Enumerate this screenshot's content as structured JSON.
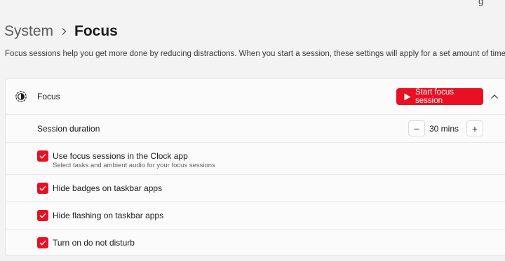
{
  "header": {
    "breadcrumb_parent": "System",
    "breadcrumb_current": "Focus",
    "partial_top_text": "g"
  },
  "description": "Focus sessions help you get more done by reducing distractions. When you start a session, these settings will apply for a set amount of time.",
  "focus_card": {
    "title": "Focus",
    "start_button_label": "Start focus session",
    "session_duration": {
      "label": "Session duration",
      "value": "30 mins",
      "decrement_label": "−",
      "increment_label": "+"
    },
    "options": [
      {
        "label": "Use focus sessions in the Clock app",
        "sublabel": "Select tasks and ambient audio for your focus sessions",
        "checked": true
      },
      {
        "label": "Hide badges on taskbar apps",
        "checked": true
      },
      {
        "label": "Hide flashing on taskbar apps",
        "checked": true
      },
      {
        "label": "Turn on do not disturb",
        "checked": true
      }
    ]
  },
  "colors": {
    "accent": "#e81123",
    "background": "#f3f3f3",
    "card": "#fbfbfb"
  },
  "icons": {
    "focus": "focus-clock-icon",
    "breadcrumb_separator": "chevron-right-icon",
    "start": "play-icon",
    "collapse": "chevron-up-icon",
    "check": "checkmark-icon"
  }
}
